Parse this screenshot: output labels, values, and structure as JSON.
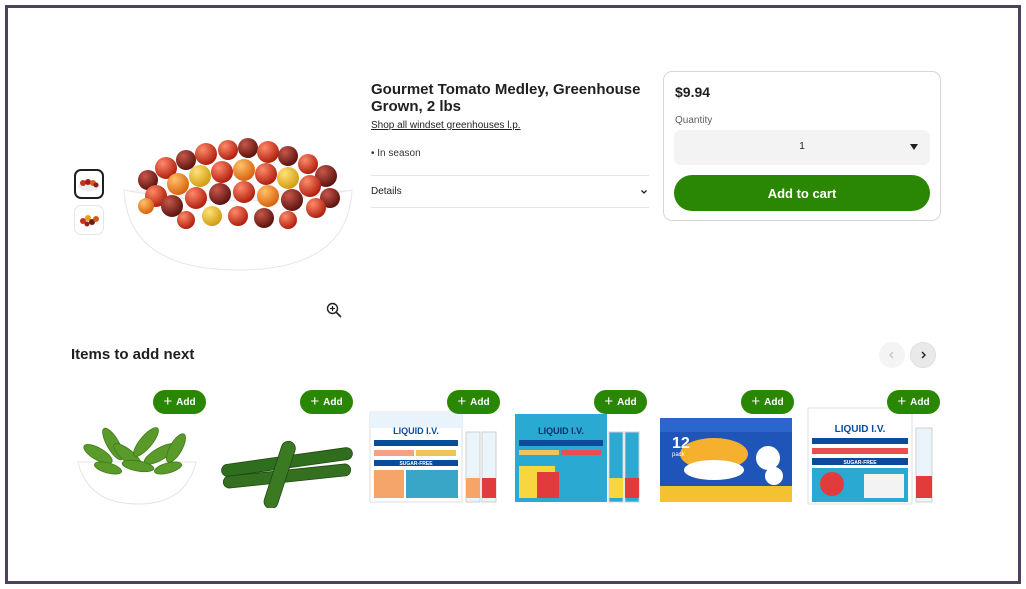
{
  "product": {
    "title": "Gourmet Tomato Medley, Greenhouse Grown, 2 lbs",
    "shop_link": "Shop all windset greenhouses l.p.",
    "season": "• In season",
    "details_label": "Details"
  },
  "buybox": {
    "price": "$9.94",
    "quantity_label": "Quantity",
    "quantity_value": "1",
    "add_to_cart": "Add to cart"
  },
  "recommendations": {
    "title": "Items to add next",
    "add_label": "Add",
    "items": [
      {
        "image": "green-beans-bowl"
      },
      {
        "image": "mini-cucumbers"
      },
      {
        "image": "liquid-iv-pack-peach",
        "brand": "LIQUID I.V.",
        "sub": "SUGAR-FREE"
      },
      {
        "image": "liquid-iv-pack-strawberry",
        "brand": "LIQUID I.V."
      },
      {
        "image": "mac-and-cheese-12-pack",
        "brand": "12",
        "sub": "pack"
      },
      {
        "image": "liquid-iv-pack-sugar-free",
        "brand": "LIQUID I.V.",
        "sub": "SUGAR-FREE"
      }
    ]
  },
  "colors": {
    "accent_green": "#2a8703",
    "frame": "#4e3f5e"
  }
}
